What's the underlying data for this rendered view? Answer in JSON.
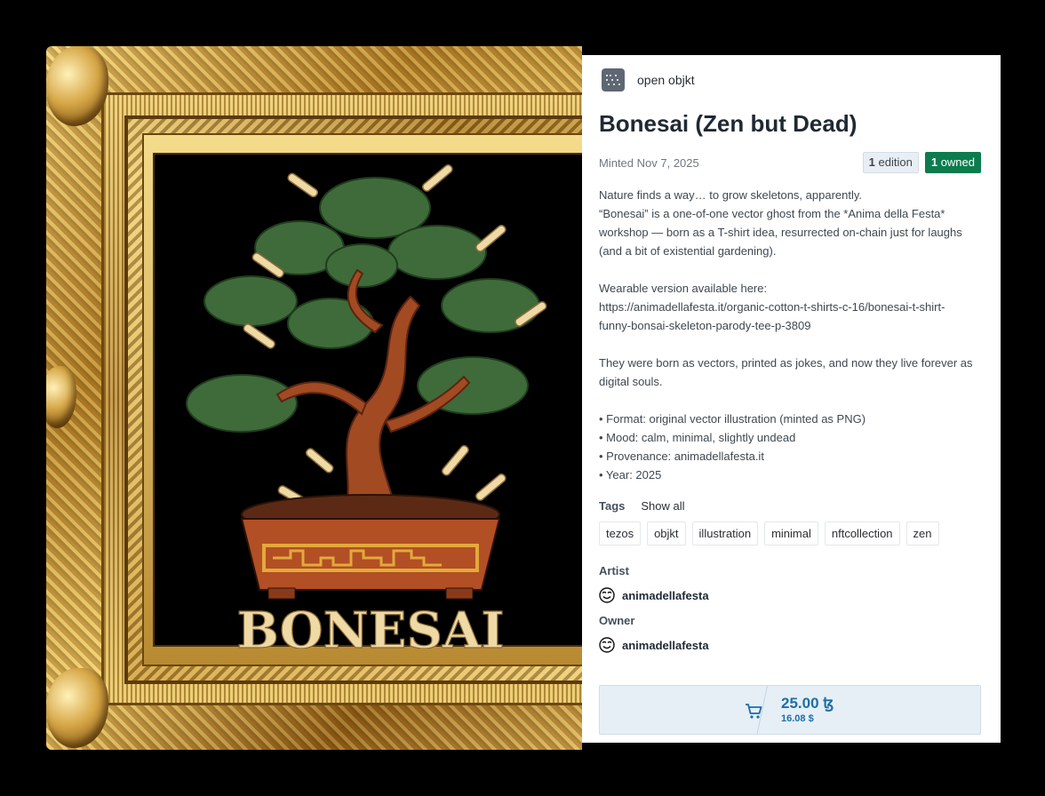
{
  "artwork": {
    "title_text": "BONESAI",
    "colors": {
      "background": "#000000",
      "foliage": "#3f6b3a",
      "trunk": "#a24a22",
      "bone": "#efd9a4",
      "pot": "#b24f25",
      "frame_gold": "#d6a646"
    }
  },
  "collection": {
    "name": "open objkt",
    "icon": "grid-icon"
  },
  "token": {
    "title": "Bonesai (Zen but Dead)",
    "minted": "Minted Nov 7, 2025",
    "edition_count": "1",
    "edition_label": "edition",
    "owned_count": "1",
    "owned_label": "owned"
  },
  "description": [
    "Nature finds a way… to grow skeletons, apparently.",
    "“Bonesai” is a one-of-one vector ghost from the *Anima della Festa*",
    "workshop — born as a T-shirt idea, resurrected on-chain just for laughs",
    "(and a bit of existential gardening).",
    "",
    "Wearable version available here:",
    "https://animadellafesta.it/organic-cotton-t-shirts-c-16/bonesai-t-shirt-",
    "funny-bonsai-skeleton-parody-tee-p-3809",
    "",
    "They were born as vectors, printed as jokes, and now they live forever as",
    "digital souls.",
    "",
    "• Format: original vector illustration (minted as PNG)",
    "• Mood: calm, minimal, slightly undead",
    "• Provenance: animadellafesta.it",
    "• Year: 2025"
  ],
  "tags": {
    "label": "Tags",
    "show_all": "Show all",
    "items": [
      "tezos",
      "objkt",
      "illustration",
      "minimal",
      "nftcollection",
      "zen"
    ]
  },
  "artist": {
    "label": "Artist",
    "name": "animadellafesta",
    "icon": "smiley-avatar-icon"
  },
  "owner": {
    "label": "Owner",
    "name": "animadellafesta",
    "icon": "smiley-avatar-icon"
  },
  "buy": {
    "price": "25.00 ꜩ",
    "price_usd": "16.08 $",
    "icon": "cart-icon",
    "accent": "#1d6fa5"
  }
}
